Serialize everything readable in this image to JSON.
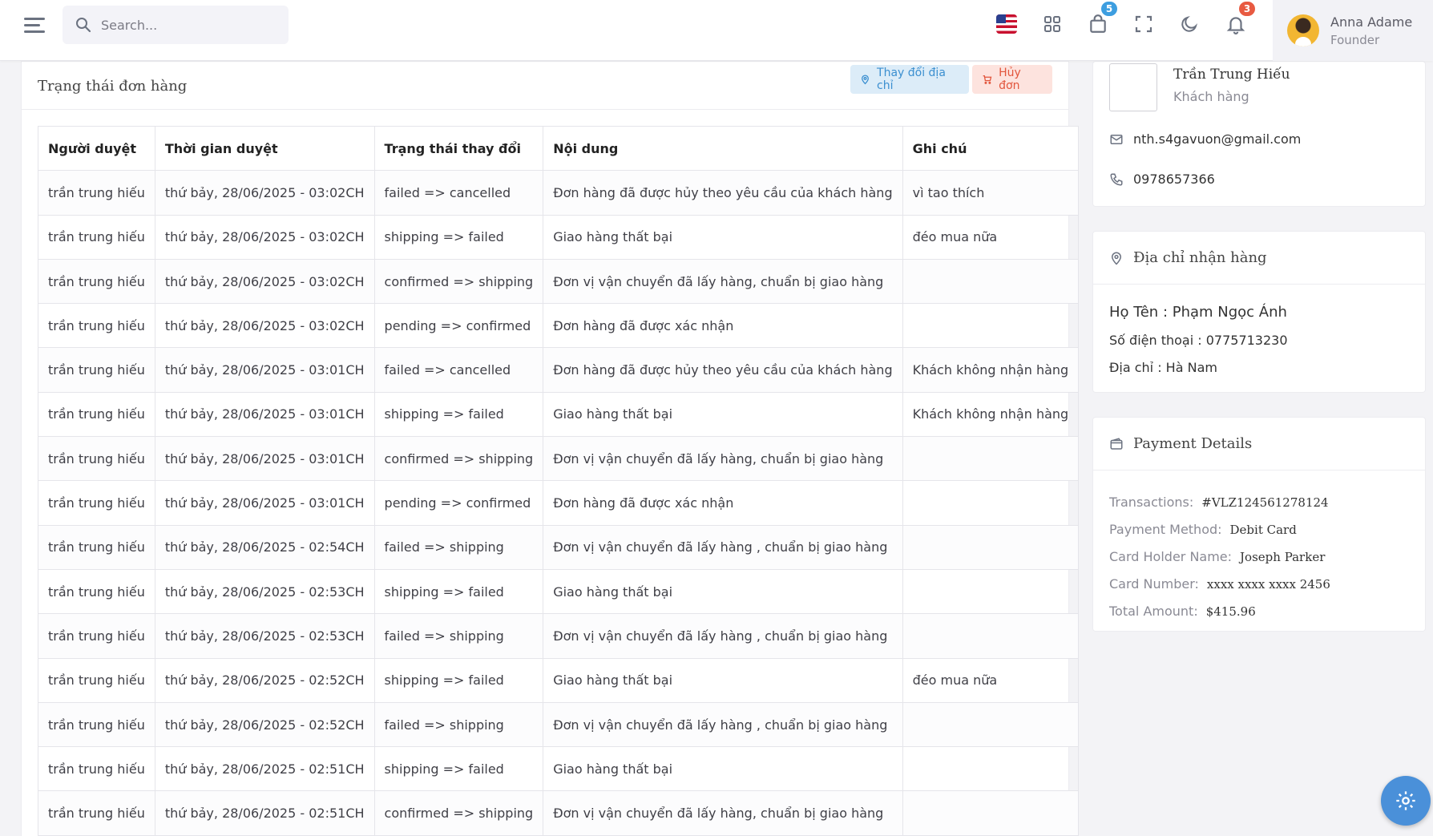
{
  "header": {
    "search_placeholder": "Search...",
    "cart_count": "5",
    "notification_count": "3",
    "user_name": "Anna Adame",
    "user_role": "Founder"
  },
  "order_status": {
    "title": "Trạng thái đơn hàng",
    "change_address_label": "Thay đổi địa chỉ",
    "cancel_order_label": "Hủy đơn",
    "columns": [
      "Người duyệt",
      "Thời gian duyệt",
      "Trạng thái thay đổi",
      "Nội dung",
      "Ghi chú"
    ],
    "rows": [
      [
        "trần trung hiếu",
        "thứ bảy, 28/06/2025 - 03:02CH",
        "failed => cancelled",
        "Đơn hàng đã được hủy theo yêu cầu của khách hàng",
        "vì tao thích"
      ],
      [
        "trần trung hiếu",
        "thứ bảy, 28/06/2025 - 03:02CH",
        "shipping => failed",
        "Giao hàng thất bại",
        "đéo mua nữa"
      ],
      [
        "trần trung hiếu",
        "thứ bảy, 28/06/2025 - 03:02CH",
        "confirmed => shipping",
        "Đơn vị vận chuyển đã lấy hàng, chuẩn bị giao hàng",
        ""
      ],
      [
        "trần trung hiếu",
        "thứ bảy, 28/06/2025 - 03:02CH",
        "pending => confirmed",
        "Đơn hàng đã được xác nhận",
        ""
      ],
      [
        "trần trung hiếu",
        "thứ bảy, 28/06/2025 - 03:01CH",
        "failed => cancelled",
        "Đơn hàng đã được hủy theo yêu cầu của khách hàng",
        "Khách không nhận hàng"
      ],
      [
        "trần trung hiếu",
        "thứ bảy, 28/06/2025 - 03:01CH",
        "shipping => failed",
        "Giao hàng thất bại",
        "Khách không nhận hàng"
      ],
      [
        "trần trung hiếu",
        "thứ bảy, 28/06/2025 - 03:01CH",
        "confirmed => shipping",
        "Đơn vị vận chuyển đã lấy hàng, chuẩn bị giao hàng",
        ""
      ],
      [
        "trần trung hiếu",
        "thứ bảy, 28/06/2025 - 03:01CH",
        "pending => confirmed",
        "Đơn hàng đã được xác nhận",
        ""
      ],
      [
        "trần trung hiếu",
        "thứ bảy, 28/06/2025 - 02:54CH",
        "failed => shipping",
        "Đơn vị vận chuyển đã lấy hàng , chuẩn bị giao hàng",
        ""
      ],
      [
        "trần trung hiếu",
        "thứ bảy, 28/06/2025 - 02:53CH",
        "shipping => failed",
        "Giao hàng thất bại",
        ""
      ],
      [
        "trần trung hiếu",
        "thứ bảy, 28/06/2025 - 02:53CH",
        "failed => shipping",
        "Đơn vị vận chuyển đã lấy hàng , chuẩn bị giao hàng",
        ""
      ],
      [
        "trần trung hiếu",
        "thứ bảy, 28/06/2025 - 02:52CH",
        "shipping => failed",
        "Giao hàng thất bại",
        "đéo mua nữa"
      ],
      [
        "trần trung hiếu",
        "thứ bảy, 28/06/2025 - 02:52CH",
        "failed => shipping",
        "Đơn vị vận chuyển đã lấy hàng , chuẩn bị giao hàng",
        ""
      ],
      [
        "trần trung hiếu",
        "thứ bảy, 28/06/2025 - 02:51CH",
        "shipping => failed",
        "Giao hàng thất bại",
        ""
      ],
      [
        "trần trung hiếu",
        "thứ bảy, 28/06/2025 - 02:51CH",
        "confirmed => shipping",
        "Đơn vị vận chuyển đã lấy hàng, chuẩn bị giao hàng",
        ""
      ]
    ]
  },
  "customer": {
    "name": "Trần Trung Hiếu",
    "role": "Khách hàng",
    "email": "nth.s4gavuon@gmail.com",
    "phone": "0978657366"
  },
  "shipping_address": {
    "title": "Địa chỉ nhận hàng",
    "full_name": "Họ Tên : Phạm Ngọc Ánh",
    "phone": "Số điện thoại : 0775713230",
    "address": "Địa chỉ : Hà Nam"
  },
  "payment": {
    "title": "Payment Details",
    "transactions_label": "Transactions:",
    "transactions_value": "#VLZ124561278124",
    "method_label": "Payment Method:",
    "method_value": "Debit Card",
    "holder_label": "Card Holder Name:",
    "holder_value": "Joseph Parker",
    "number_label": "Card Number:",
    "number_value": "xxxx xxxx xxxx 2456",
    "total_label": "Total Amount:",
    "total_value": "$415.96"
  },
  "colors": {
    "accent_blue": "#3b8fd0",
    "danger": "#e2553c",
    "badge_blue": "#3d9ee0",
    "badge_red": "#e85a41"
  }
}
